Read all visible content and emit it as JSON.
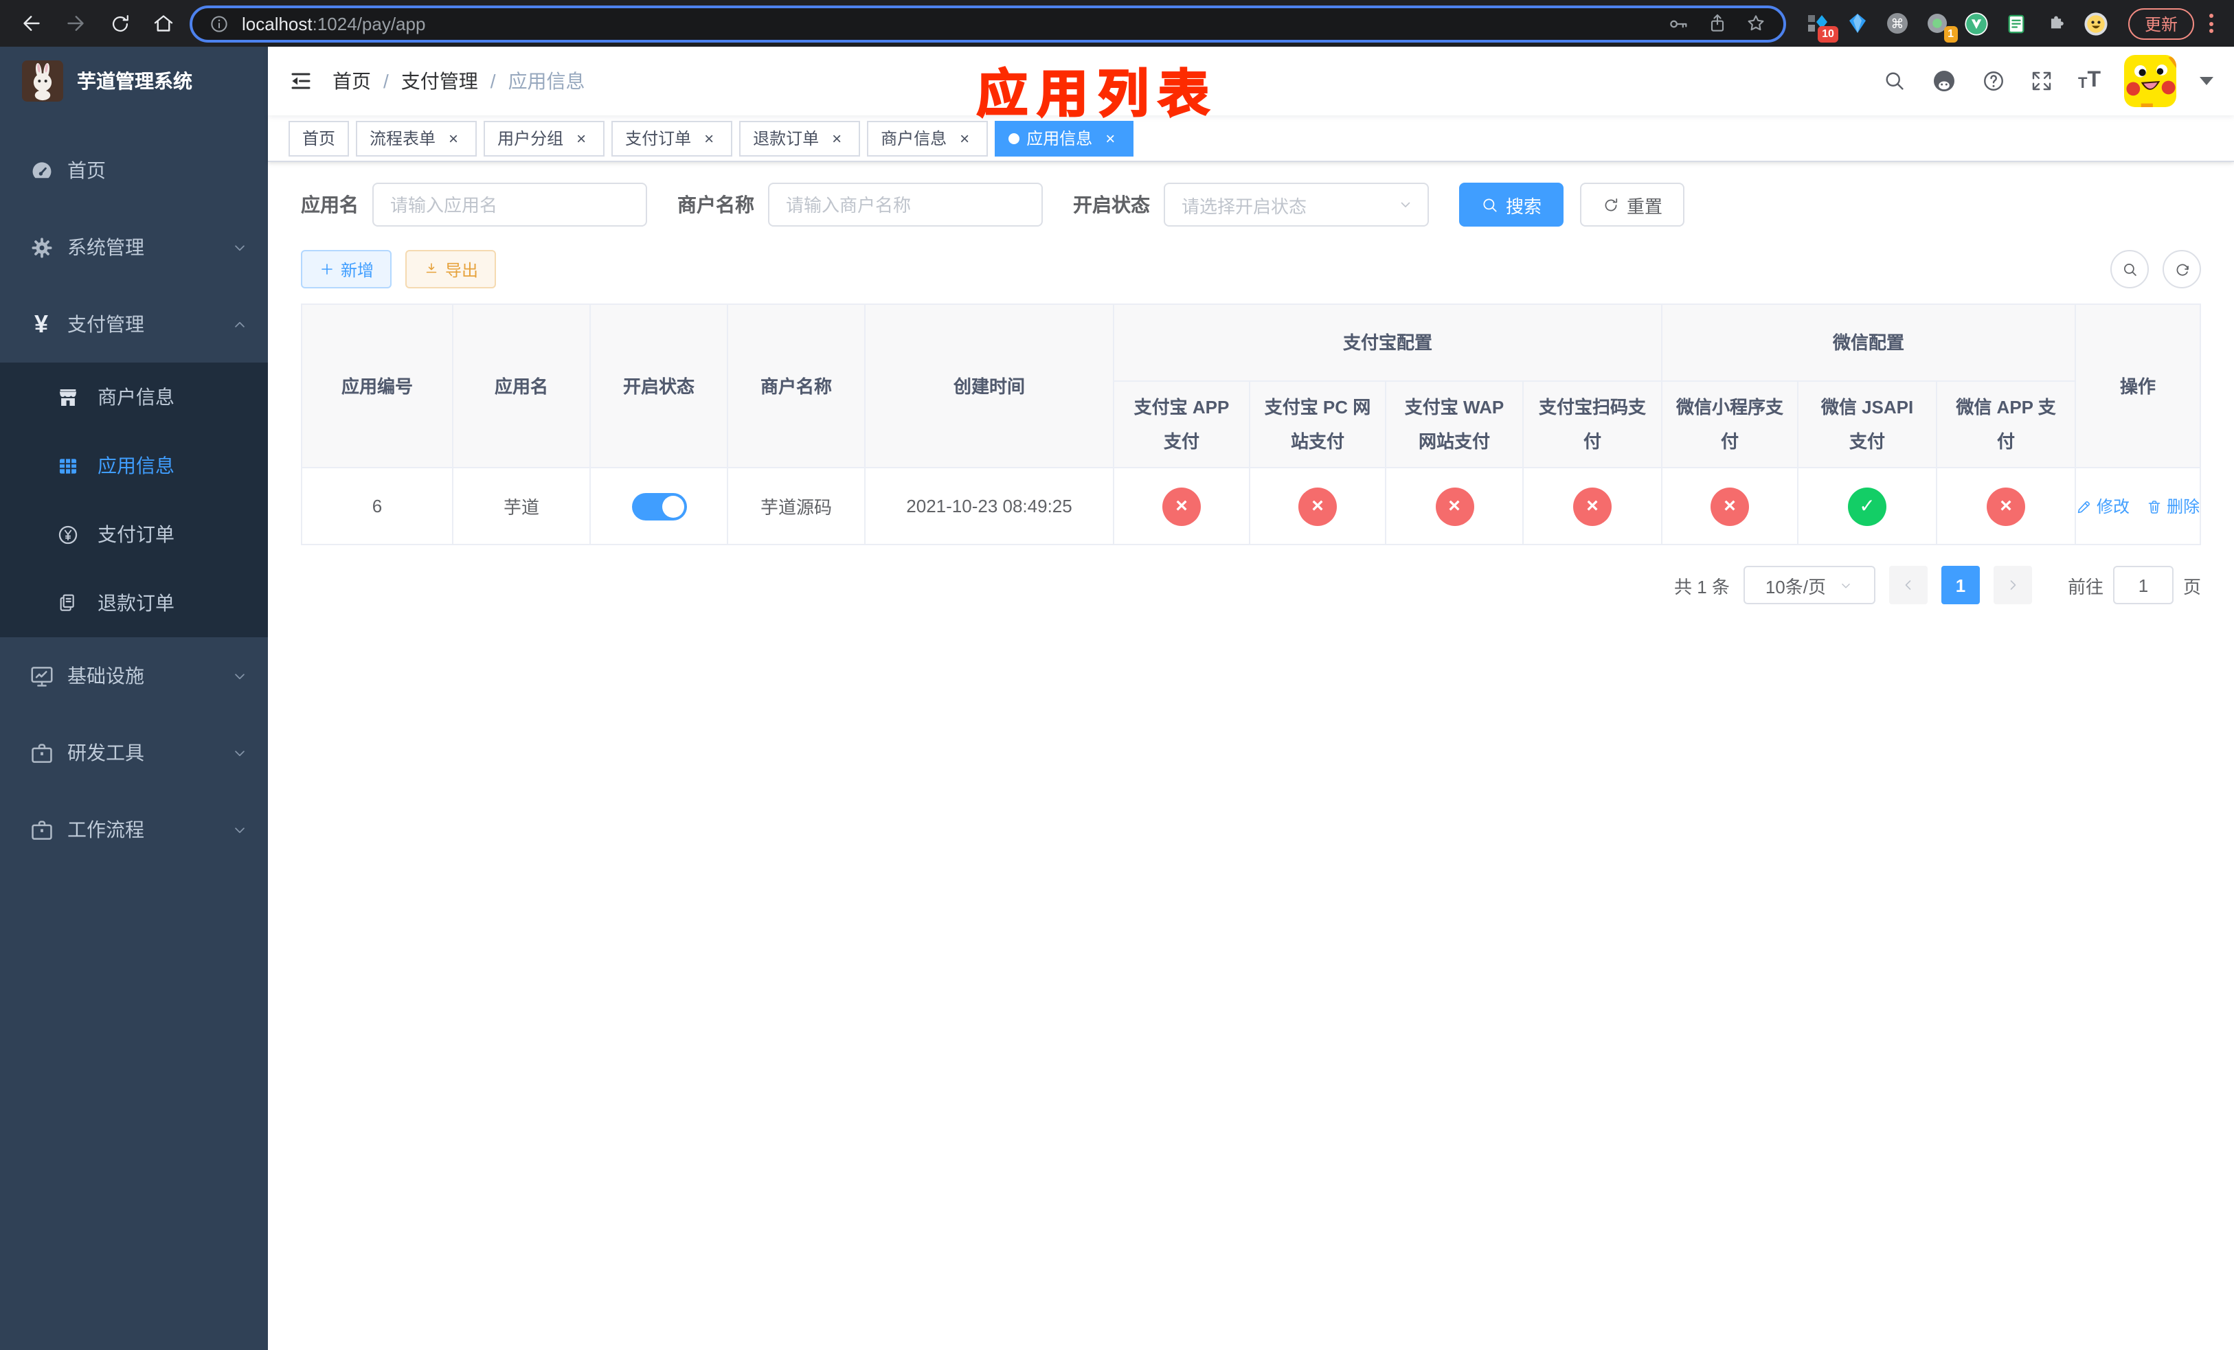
{
  "colors": {
    "accent": "#409eff",
    "danger": "#f56c6c",
    "success": "#13ce66",
    "sidebar_bg": "#304156",
    "submenu_bg": "#1f2d3d",
    "annotation": "#fd2b00"
  },
  "browser": {
    "url_host": "localhost",
    "url_rest": ":1024/pay/app",
    "update_label": "更新",
    "ext_badge_count_a": "10",
    "ext_badge_count_b": "1"
  },
  "annotation": {
    "title": "应用列表"
  },
  "sidebar": {
    "title": "芋道管理系统",
    "menu": [
      {
        "label": "首页"
      },
      {
        "label": "系统管理"
      },
      {
        "label": "支付管理"
      },
      {
        "label": "商户信息"
      },
      {
        "label": "应用信息"
      },
      {
        "label": "支付订单"
      },
      {
        "label": "退款订单"
      },
      {
        "label": "基础设施"
      },
      {
        "label": "研发工具"
      },
      {
        "label": "工作流程"
      }
    ]
  },
  "navbar": {
    "breadcrumb": [
      "首页",
      "支付管理",
      "应用信息"
    ]
  },
  "tabs": [
    {
      "label": "首页",
      "closable": false
    },
    {
      "label": "流程表单",
      "closable": true
    },
    {
      "label": "用户分组",
      "closable": true
    },
    {
      "label": "支付订单",
      "closable": true
    },
    {
      "label": "退款订单",
      "closable": true
    },
    {
      "label": "商户信息",
      "closable": true
    },
    {
      "label": "应用信息",
      "closable": true,
      "active": true
    }
  ],
  "filters": {
    "app_name_label": "应用名",
    "app_name_placeholder": "请输入应用名",
    "merchant_label": "商户名称",
    "merchant_placeholder": "请输入商户名称",
    "status_label": "开启状态",
    "status_placeholder": "请选择开启状态",
    "search_label": "搜索",
    "reset_label": "重置"
  },
  "toolbar": {
    "add_label": "新增",
    "export_label": "导出"
  },
  "table": {
    "columns": {
      "id": "应用编号",
      "name": "应用名",
      "enabled": "开启状态",
      "merchant": "商户名称",
      "created": "创建时间",
      "alipay_group": "支付宝配置",
      "wechat_group": "微信配置",
      "alipay_app": "支付宝 APP 支付",
      "alipay_pc": "支付宝 PC 网站支付",
      "alipay_wap": "支付宝 WAP 网站支付",
      "alipay_qr": "支付宝扫码支付",
      "wechat_lite": "微信小程序支付",
      "wechat_jsapi": "微信 JSAPI 支付",
      "wechat_app": "微信 APP 支付",
      "actions": "操作"
    },
    "row": {
      "id": "6",
      "name": "芋道",
      "enabled": true,
      "merchant": "芋道源码",
      "created": "2021-10-23 08:49:25",
      "statuses": {
        "alipay_app": false,
        "alipay_pc": false,
        "alipay_wap": false,
        "alipay_qr": false,
        "wechat_lite": false,
        "wechat_jsapi": true,
        "wechat_app": false
      },
      "edit_label": "修改",
      "delete_label": "删除"
    }
  },
  "pagination": {
    "total_label": "共 1 条",
    "page_size_label": "10条/页",
    "current_page": "1",
    "goto_prefix": "前往",
    "goto_value": "1",
    "goto_suffix": "页"
  }
}
